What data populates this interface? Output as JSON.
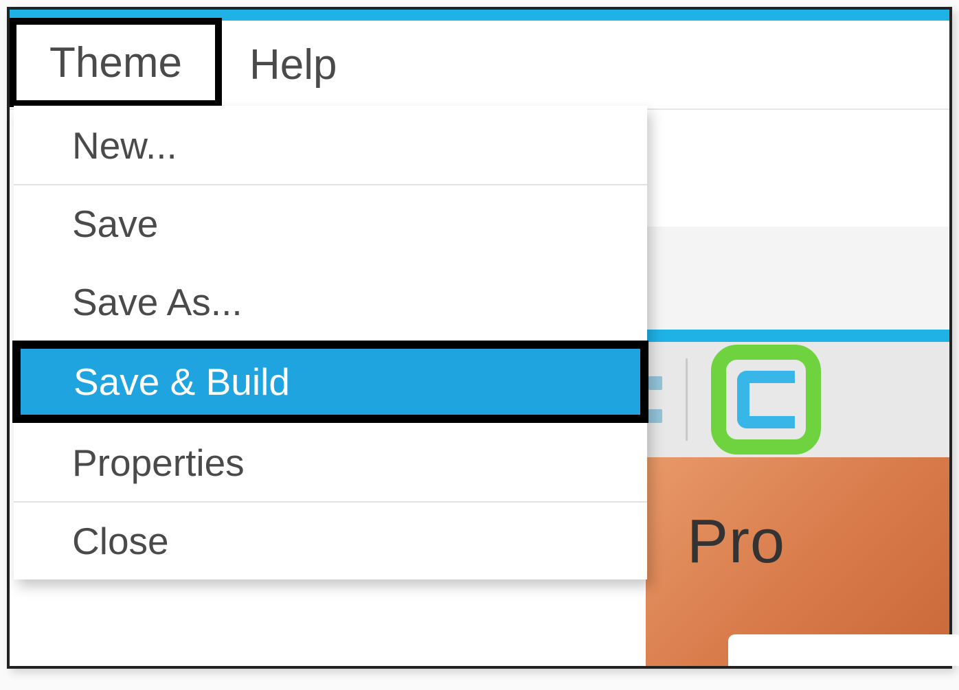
{
  "menubar": {
    "items": [
      {
        "label": "Theme",
        "active": true
      },
      {
        "label": "Help",
        "active": false
      }
    ]
  },
  "dropdown": {
    "items": [
      {
        "label": "New...",
        "highlighted": false,
        "sep_above": false
      },
      {
        "label": "Save",
        "highlighted": false,
        "sep_above": true
      },
      {
        "label": "Save As...",
        "highlighted": false,
        "sep_above": false
      },
      {
        "label": "Save & Build",
        "highlighted": true,
        "sep_above": false
      },
      {
        "label": "Properties",
        "highlighted": false,
        "sep_above": false
      },
      {
        "label": "Close",
        "highlighted": false,
        "sep_above": true
      }
    ]
  },
  "hero": {
    "title_fragment": "Pro"
  },
  "colors": {
    "accent": "#1fb2e7",
    "highlight": "#20a4df",
    "logo_border": "#6fd33f",
    "logo_c": "#38b6e8"
  }
}
